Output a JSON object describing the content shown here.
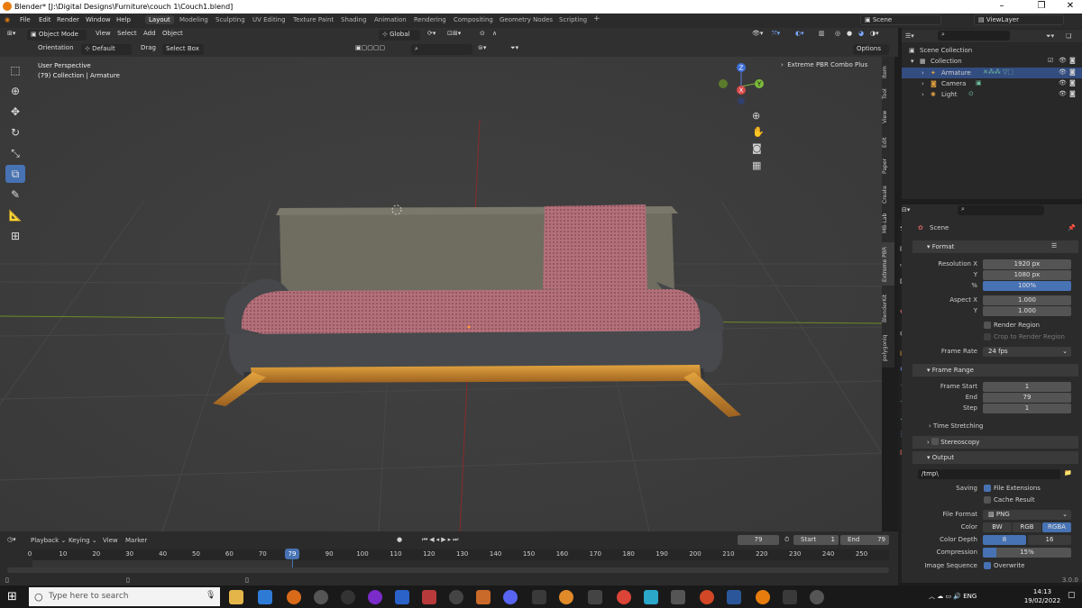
{
  "window": {
    "title": "Blender* [J:\\Digital Designs\\Furniture\\couch 1\\Couch1.blend]"
  },
  "menu": [
    "File",
    "Edit",
    "Render",
    "Window",
    "Help"
  ],
  "workspaces": [
    "Layout",
    "Modeling",
    "Sculpting",
    "UV Editing",
    "Texture Paint",
    "Shading",
    "Animation",
    "Rendering",
    "Compositing",
    "Geometry Nodes",
    "Scripting"
  ],
  "scene_name": "Scene",
  "view_layer": "ViewLayer",
  "viewport_header": {
    "mode": "Object Mode",
    "menus": [
      "View",
      "Select",
      "Add",
      "Object"
    ],
    "transform": "Global"
  },
  "tool_header": {
    "orientation_label": "Orientation",
    "orientation_value": "Default",
    "drag_label": "Drag",
    "drag_value": "Select Box",
    "options": "Options"
  },
  "viewport": {
    "perspective": "User Perspective",
    "collection_info": "(79) Collection | Armature",
    "addon_panel": "Extreme PBR Combo Plus",
    "gizmo_axes": [
      "Z",
      "X",
      "Y"
    ]
  },
  "sidebar_tabs": [
    "Item",
    "Tool",
    "View",
    "Edit",
    "Paper",
    "Create",
    "MB-Lab",
    "Extreme PBR",
    "BlenderKit",
    "polygoniq"
  ],
  "outliner": {
    "root": "Scene Collection",
    "collection": "Collection",
    "items": [
      "Armature",
      "Camera",
      "Light"
    ]
  },
  "properties": {
    "context": "Scene",
    "format": {
      "title": "Format",
      "res_x_label": "Resolution X",
      "res_x": "1920 px",
      "res_y_label": "Y",
      "res_y": "1080 px",
      "pct_label": "%",
      "pct": "100%",
      "aspect_x_label": "Aspect X",
      "aspect_x": "1.000",
      "aspect_y_label": "Y",
      "aspect_y": "1.000",
      "render_region": "Render Region",
      "crop": "Crop to Render Region",
      "frame_rate_label": "Frame Rate",
      "frame_rate": "24 fps"
    },
    "frame_range": {
      "title": "Frame Range",
      "start_label": "Frame Start",
      "start": "1",
      "end_label": "End",
      "end": "79",
      "step_label": "Step",
      "step": "1",
      "time_stretching": "Time Stretching"
    },
    "stereoscopy": "Stereoscopy",
    "output": {
      "title": "Output",
      "path": "/tmp\\",
      "saving_label": "Saving",
      "file_extensions": "File Extensions",
      "cache_result": "Cache Result",
      "file_format_label": "File Format",
      "file_format": "PNG",
      "color_label": "Color",
      "color_opts": [
        "BW",
        "RGB",
        "RGBA"
      ],
      "depth_label": "Color Depth",
      "depth_opts": [
        "8",
        "16"
      ],
      "compression_label": "Compression",
      "compression": "15%",
      "sequence_label": "Image Sequence",
      "overwrite": "Overwrite"
    }
  },
  "timeline": {
    "menus": [
      "Playback",
      "Keying",
      "View",
      "Marker"
    ],
    "current_frame": "79",
    "start_label": "Start",
    "start": "1",
    "end_label": "End",
    "end": "79",
    "frames": [
      "0",
      "10",
      "20",
      "30",
      "40",
      "50",
      "60",
      "70",
      "80",
      "90",
      "100",
      "110",
      "120",
      "130",
      "140",
      "150",
      "160",
      "170",
      "180",
      "190",
      "200",
      "210",
      "220",
      "230",
      "240",
      "250"
    ],
    "playhead": "79"
  },
  "version": "3.0.0",
  "taskbar": {
    "search_placeholder": "Type here to search",
    "time": "14:13",
    "date": "19/02/2022"
  }
}
